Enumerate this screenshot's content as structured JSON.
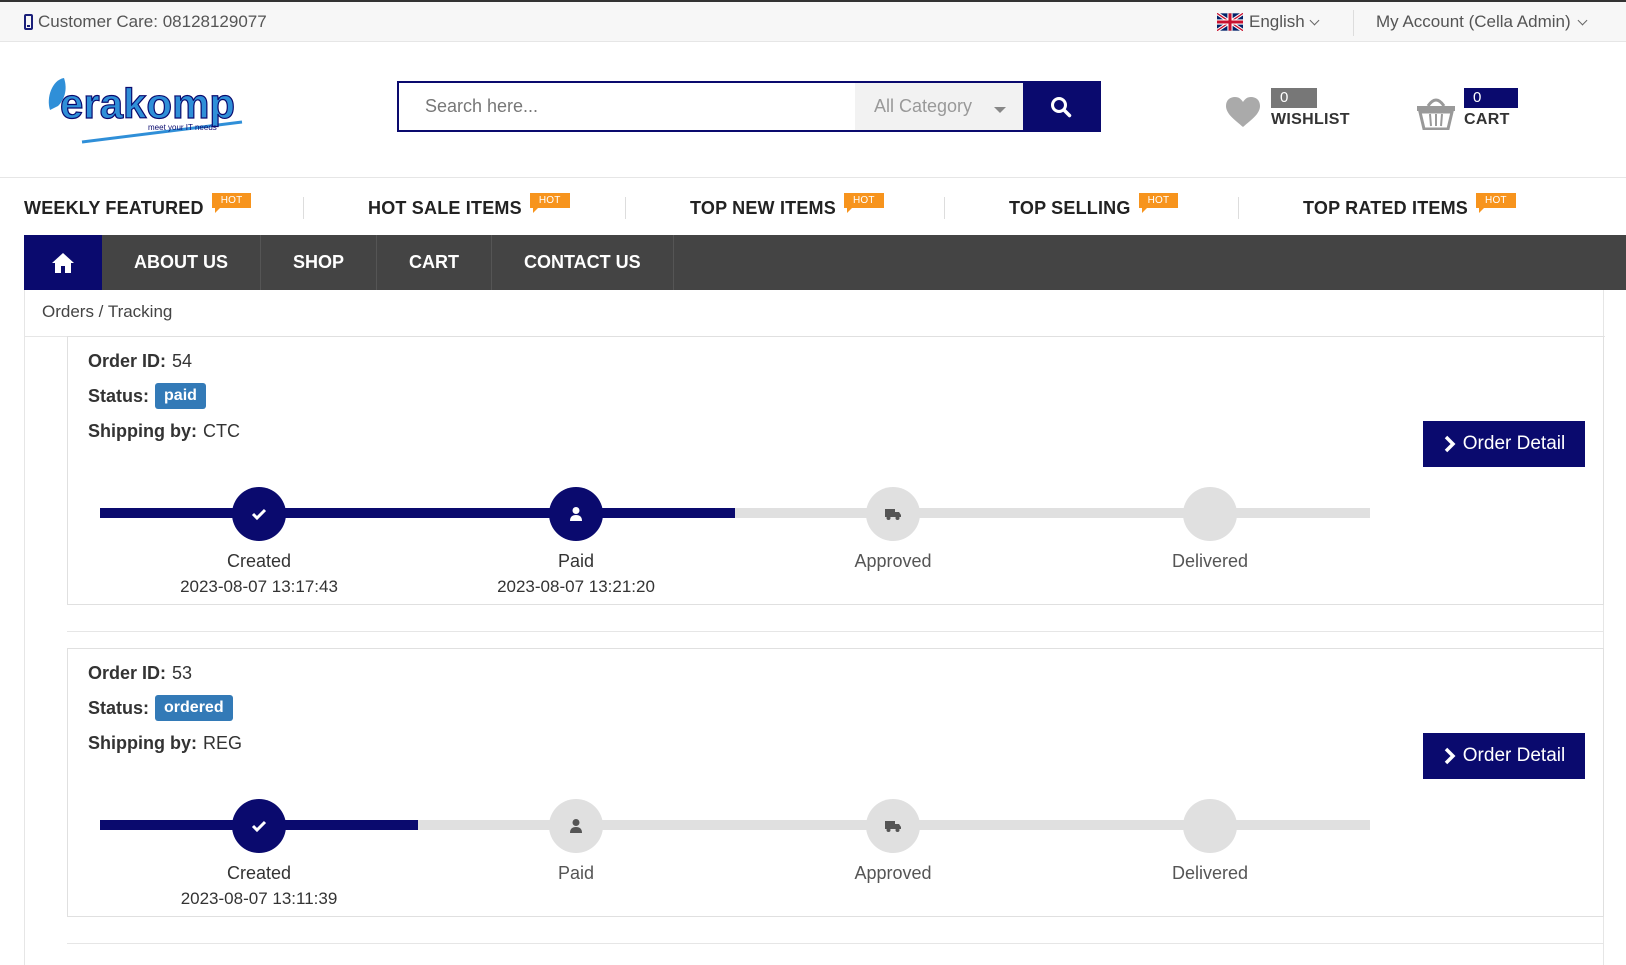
{
  "topbar": {
    "customer_care": "Customer Care: 08128129077",
    "language": "English",
    "account": "My Account (Cella Admin)"
  },
  "header": {
    "search_placeholder": "Search here...",
    "category": "All Category",
    "wishlist_count": "0 item",
    "wishlist_label": "WISHLIST",
    "cart_count": "0 items",
    "cart_label": "CART",
    "logo_text": "erakomp",
    "logo_tagline": "meet your IT needs"
  },
  "categories": [
    {
      "label": "WEEKLY FEATURED",
      "badge": "HOT"
    },
    {
      "label": "HOT SALE ITEMS",
      "badge": "HOT"
    },
    {
      "label": "TOP NEW ITEMS",
      "badge": "HOT"
    },
    {
      "label": "TOP SELLING",
      "badge": "HOT"
    },
    {
      "label": "TOP RATED ITEMS",
      "badge": "HOT"
    }
  ],
  "nav": {
    "items": [
      "ABOUT US",
      "SHOP",
      "CART",
      "CONTACT US"
    ]
  },
  "breadcrumb": "Orders / Tracking",
  "labels": {
    "order_id": "Order ID:",
    "status": "Status:",
    "shipping_by": "Shipping by:",
    "order_detail": "Order Detail"
  },
  "orders": [
    {
      "id": "54",
      "status": "paid",
      "shipping": "CTC",
      "progress": 0.5,
      "steps": [
        {
          "name": "Created",
          "time": "2023-08-07 13:17:43",
          "done": true,
          "icon": "check-icon"
        },
        {
          "name": "Paid",
          "time": "2023-08-07 13:21:20",
          "done": true,
          "icon": "user-icon"
        },
        {
          "name": "Approved",
          "time": "",
          "done": false,
          "icon": "truck-icon"
        },
        {
          "name": "Delivered",
          "time": "",
          "done": false,
          "icon": ""
        }
      ]
    },
    {
      "id": "53",
      "status": "ordered",
      "shipping": "REG",
      "progress": 0.25,
      "steps": [
        {
          "name": "Created",
          "time": "2023-08-07 13:11:39",
          "done": true,
          "icon": "check-icon"
        },
        {
          "name": "Paid",
          "time": "",
          "done": false,
          "icon": "user-icon"
        },
        {
          "name": "Approved",
          "time": "",
          "done": false,
          "icon": "truck-icon"
        },
        {
          "name": "Delivered",
          "time": "",
          "done": false,
          "icon": ""
        }
      ]
    }
  ],
  "colors": {
    "primary": "#0a0a6e",
    "track_inactive": "#e0e0e0",
    "badge": "#337ab7",
    "hot": "#f7941d",
    "nav_bg": "#444444"
  }
}
